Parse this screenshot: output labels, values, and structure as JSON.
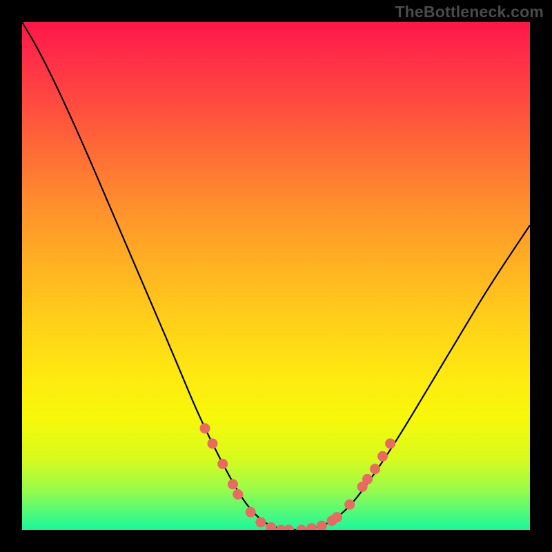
{
  "watermark": "TheBottleneck.com",
  "chart_data": {
    "type": "line",
    "title": "",
    "xlabel": "",
    "ylabel": "",
    "xlim": [
      0,
      100
    ],
    "ylim": [
      0,
      100
    ],
    "grid": false,
    "legend": false,
    "curve": [
      {
        "x": 0,
        "y": 100
      },
      {
        "x": 3,
        "y": 95
      },
      {
        "x": 7,
        "y": 87
      },
      {
        "x": 12,
        "y": 76
      },
      {
        "x": 18,
        "y": 62
      },
      {
        "x": 24,
        "y": 48
      },
      {
        "x": 30,
        "y": 34
      },
      {
        "x": 35,
        "y": 22
      },
      {
        "x": 40,
        "y": 12
      },
      {
        "x": 44,
        "y": 5
      },
      {
        "x": 48,
        "y": 1
      },
      {
        "x": 52,
        "y": 0
      },
      {
        "x": 56,
        "y": 0
      },
      {
        "x": 60,
        "y": 1
      },
      {
        "x": 64,
        "y": 4
      },
      {
        "x": 68,
        "y": 9
      },
      {
        "x": 74,
        "y": 18
      },
      {
        "x": 80,
        "y": 28
      },
      {
        "x": 86,
        "y": 38
      },
      {
        "x": 92,
        "y": 48
      },
      {
        "x": 100,
        "y": 60
      }
    ],
    "markers": [
      {
        "x": 36,
        "y": 20
      },
      {
        "x": 37.5,
        "y": 17
      },
      {
        "x": 39.5,
        "y": 13
      },
      {
        "x": 41.5,
        "y": 9
      },
      {
        "x": 42.5,
        "y": 7
      },
      {
        "x": 45,
        "y": 3.5
      },
      {
        "x": 47,
        "y": 1.5
      },
      {
        "x": 49,
        "y": 0.5
      },
      {
        "x": 51,
        "y": 0
      },
      {
        "x": 52.5,
        "y": 0
      },
      {
        "x": 55,
        "y": 0
      },
      {
        "x": 57,
        "y": 0.3
      },
      {
        "x": 59,
        "y": 0.8
      },
      {
        "x": 61,
        "y": 1.8
      },
      {
        "x": 62,
        "y": 2.5
      },
      {
        "x": 64.5,
        "y": 5
      },
      {
        "x": 67,
        "y": 8.5
      },
      {
        "x": 68,
        "y": 10
      },
      {
        "x": 69.5,
        "y": 12
      },
      {
        "x": 71,
        "y": 14.5
      },
      {
        "x": 72.5,
        "y": 17
      }
    ],
    "colors": {
      "curve": "#000000",
      "markers": "#e86a63",
      "background_top": "#ff1648",
      "background_bottom": "#19f79a"
    }
  }
}
